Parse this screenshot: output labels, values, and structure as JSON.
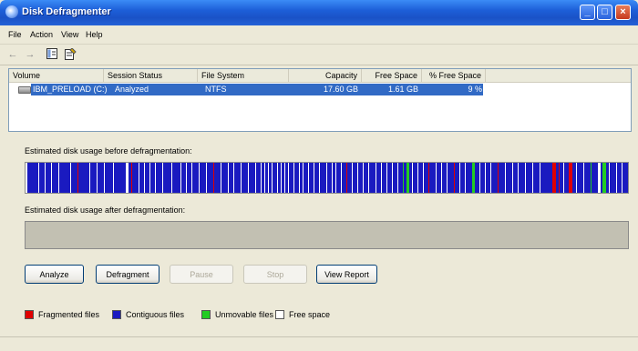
{
  "window": {
    "title": "Disk Defragmenter"
  },
  "menu": [
    "File",
    "Action",
    "View",
    "Help"
  ],
  "toolbar": {
    "back": "back-icon",
    "forward": "forward-icon",
    "show_hide": "console-tree-icon",
    "properties": "properties-icon"
  },
  "volume_list": {
    "columns": [
      "Volume",
      "Session Status",
      "File System",
      "Capacity",
      "Free Space",
      "% Free Space"
    ],
    "rows": [
      {
        "volume": "IBM_PRELOAD (C:)",
        "status": "Analyzed",
        "fs": "NTFS",
        "capacity": "17.60 GB",
        "free": "1.61 GB",
        "pct_free": "9 %"
      }
    ]
  },
  "labels": {
    "before": "Estimated disk usage before defragmentation:",
    "after": "Estimated disk usage after defragmentation:"
  },
  "buttons": {
    "analyze": "Analyze",
    "defragment": "Defragment",
    "pause": "Pause",
    "stop": "Stop",
    "view_report": "View Report"
  },
  "legend": [
    {
      "label": "Fragmented files",
      "color": "#e00000"
    },
    {
      "label": "Contiguous files",
      "color": "#1a1ac0"
    },
    {
      "label": "Unmovable files",
      "color": "#22cc22"
    },
    {
      "label": "Free space",
      "color": "#ffffff"
    }
  ],
  "colors": {
    "fragmented": "#e00000",
    "contiguous": "#1a1ac0",
    "unmovable": "#22cc22",
    "free": "#ffffff",
    "selection": "#316ac5"
  }
}
